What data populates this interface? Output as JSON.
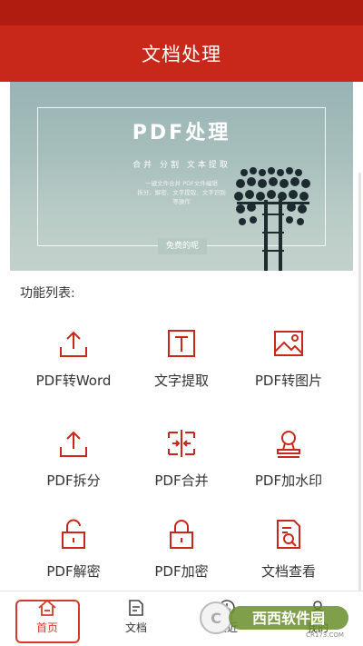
{
  "header": {
    "title": "文档处理"
  },
  "banner": {
    "title": "PDF处理",
    "subtitle": "合并  分割  文本提取",
    "desc_line1": "一键文件合并 PDF文件编辑",
    "desc_line2": "拆分、解密、文字提取、文字识别",
    "desc_line3": "等操作",
    "bottom_text": "免费的呢"
  },
  "section_label": "功能列表:",
  "functions": [
    {
      "label": "PDF转Word",
      "icon": "upload-icon"
    },
    {
      "label": "文字提取",
      "icon": "text-t-icon"
    },
    {
      "label": "PDF转图片",
      "icon": "image-icon"
    },
    {
      "label": "PDF拆分",
      "icon": "upload-icon"
    },
    {
      "label": "PDF合并",
      "icon": "merge-icon"
    },
    {
      "label": "PDF加水印",
      "icon": "stamp-icon"
    },
    {
      "label": "PDF解密",
      "icon": "unlock-icon"
    },
    {
      "label": "PDF加密",
      "icon": "lock-icon"
    },
    {
      "label": "文档查看",
      "icon": "document-search-icon"
    }
  ],
  "nav": {
    "home": "首页",
    "docs": "文档",
    "recent": "最近",
    "mine": "我的"
  },
  "watermark": {
    "brand": "西西软件园",
    "url": "CR173.COM"
  },
  "colors": {
    "primary": "#c8281a",
    "status_bar": "#b01c10",
    "icon": "#c8281a"
  }
}
